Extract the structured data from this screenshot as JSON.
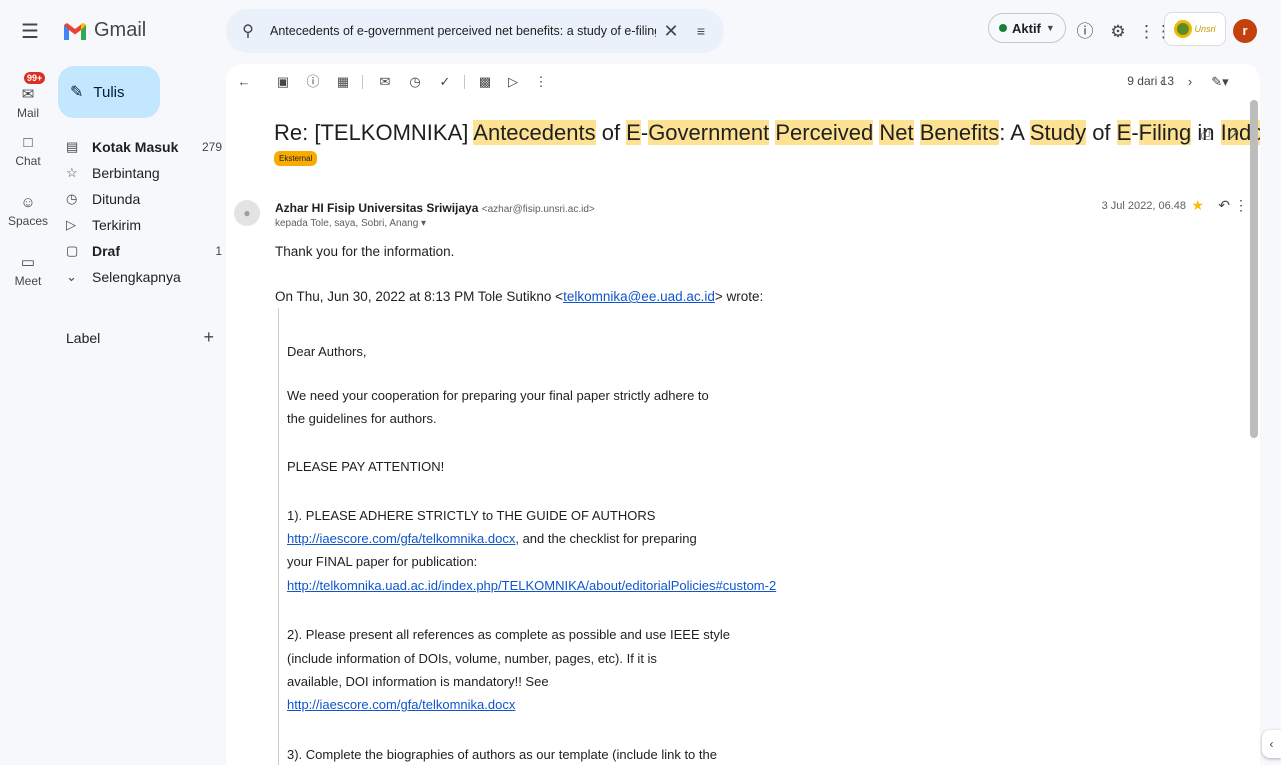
{
  "header": {
    "app_name": "Gmail",
    "search_value": "Antecedents of e-government perceived net benefits: a study of e-filing in Indo",
    "status_label": "Aktif",
    "org_logo_text": "Unsri",
    "avatar_letter": "r"
  },
  "rail": {
    "mail_badge": "99+",
    "items": [
      {
        "label": "Mail"
      },
      {
        "label": "Chat"
      },
      {
        "label": "Spaces"
      },
      {
        "label": "Meet"
      }
    ]
  },
  "sidebar": {
    "compose_label": "Tulis",
    "items": [
      {
        "label": "Kotak Masuk",
        "count": "279",
        "bold": true
      },
      {
        "label": "Berbintang",
        "count": ""
      },
      {
        "label": "Ditunda",
        "count": ""
      },
      {
        "label": "Terkirim",
        "count": ""
      },
      {
        "label": "Draf",
        "count": "1",
        "bold": true
      },
      {
        "label": "Selengkapnya",
        "count": ""
      }
    ],
    "label_heading": "Label",
    "label_add": "+"
  },
  "toolbar": {
    "pager": "9 dari 13"
  },
  "email": {
    "subject_parts": [
      "Re: [TELKOMNIKA] ",
      "Antecedents",
      " of ",
      "E",
      "-",
      "Government",
      " ",
      "Perceived",
      " ",
      "Net",
      " ",
      "Benefits",
      ": A ",
      "Study",
      " of ",
      "E",
      "-",
      "Filing",
      " in ",
      "Indonesia"
    ],
    "external_badge": "Eksternal",
    "sender_name": "Azhar HI Fisip Universitas Sriwijaya",
    "sender_email": "<azhar@fisip.unsri.ac.id>",
    "recipients": "kepada Tole, saya, Sobri, Anang",
    "date": "3 Jul 2022, 06.48",
    "reply_text": "Thank you for the information.",
    "quote_intro_prefix": "On Thu, Jun 30, 2022 at 8:13 PM Tole Sutikno <",
    "quote_intro_link": "telkomnika@ee.uad.ac.id",
    "quote_intro_suffix": "> wrote:",
    "quoted": {
      "greeting": "Dear Authors,",
      "p1_line1": "We need your cooperation for preparing your final paper strictly adhere to",
      "p1_line2": "the guidelines for authors.",
      "attention": "PLEASE PAY ATTENTION!",
      "item1_line1": "1). PLEASE ADHERE STRICTLY to THE GUIDE OF AUTHORS",
      "item1_link1": "http://iaescore.com/gfa/telkomnika.docx",
      "item1_line2_suffix": ", and the checklist for preparing",
      "item1_line3": "your FINAL paper for publication:",
      "item1_link2": "http://telkomnika.uad.ac.id/index.php/TELKOMNIKA/about/editorialPolicies#custom-2",
      "item2_line1": "2). Please present all references as complete as possible and use IEEE style",
      "item2_line2": "(include information of DOIs, volume, number, pages, etc). If it is",
      "item2_line3": "available, DOI information is mandatory!! See",
      "item2_link": "http://iaescore.com/gfa/telkomnika.docx",
      "item3_line1": "3). Complete the biographies of authors as our template (include link to the"
    }
  }
}
